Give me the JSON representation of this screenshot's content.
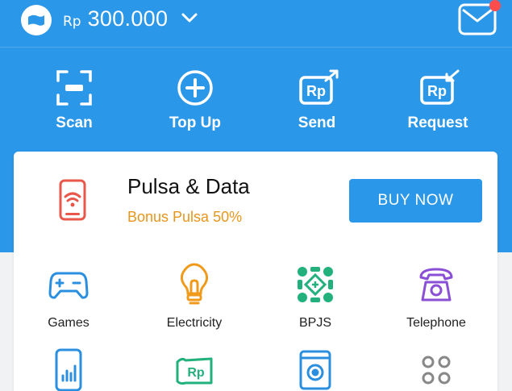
{
  "header": {
    "currency": "Rp",
    "balance": "300.000",
    "icons": {
      "wallet": "wallet-icon",
      "expand": "chevron-down-icon",
      "inbox": "mail-icon"
    }
  },
  "actions": [
    {
      "label": "Scan",
      "icon": "scan-icon"
    },
    {
      "label": "Top Up",
      "icon": "plus-circle-icon"
    },
    {
      "label": "Send",
      "icon": "send-money-icon",
      "glyph": "Rp"
    },
    {
      "label": "Request",
      "icon": "request-money-icon",
      "glyph": "Rp"
    }
  ],
  "promo": {
    "title": "Pulsa & Data",
    "subtitle": "Bonus Pulsa 50%",
    "button": "BUY NOW",
    "icon": "phone-signal-icon"
  },
  "services": [
    {
      "label": "Games",
      "icon": "gamepad-icon",
      "color": "#2b8fe0"
    },
    {
      "label": "Electricity",
      "icon": "lightbulb-icon",
      "color": "#f09a1c"
    },
    {
      "label": "BPJS",
      "icon": "bpjs-icon",
      "color": "#22b07d"
    },
    {
      "label": "Telephone",
      "icon": "telephone-icon",
      "color": "#8a4fd6"
    },
    {
      "label": "",
      "icon": "mobile-chart-icon",
      "color": "#2b8fe0"
    },
    {
      "label": "",
      "icon": "banknote-icon",
      "color": "#22b07d",
      "glyph": "Rp"
    },
    {
      "label": "",
      "icon": "safe-icon",
      "color": "#2b8fe0"
    },
    {
      "label": "",
      "icon": "more-grid-icon",
      "color": "#888888"
    }
  ],
  "colors": {
    "primary": "#2b97e8",
    "accent": "#e8951c",
    "alert": "#ff4d4d"
  }
}
